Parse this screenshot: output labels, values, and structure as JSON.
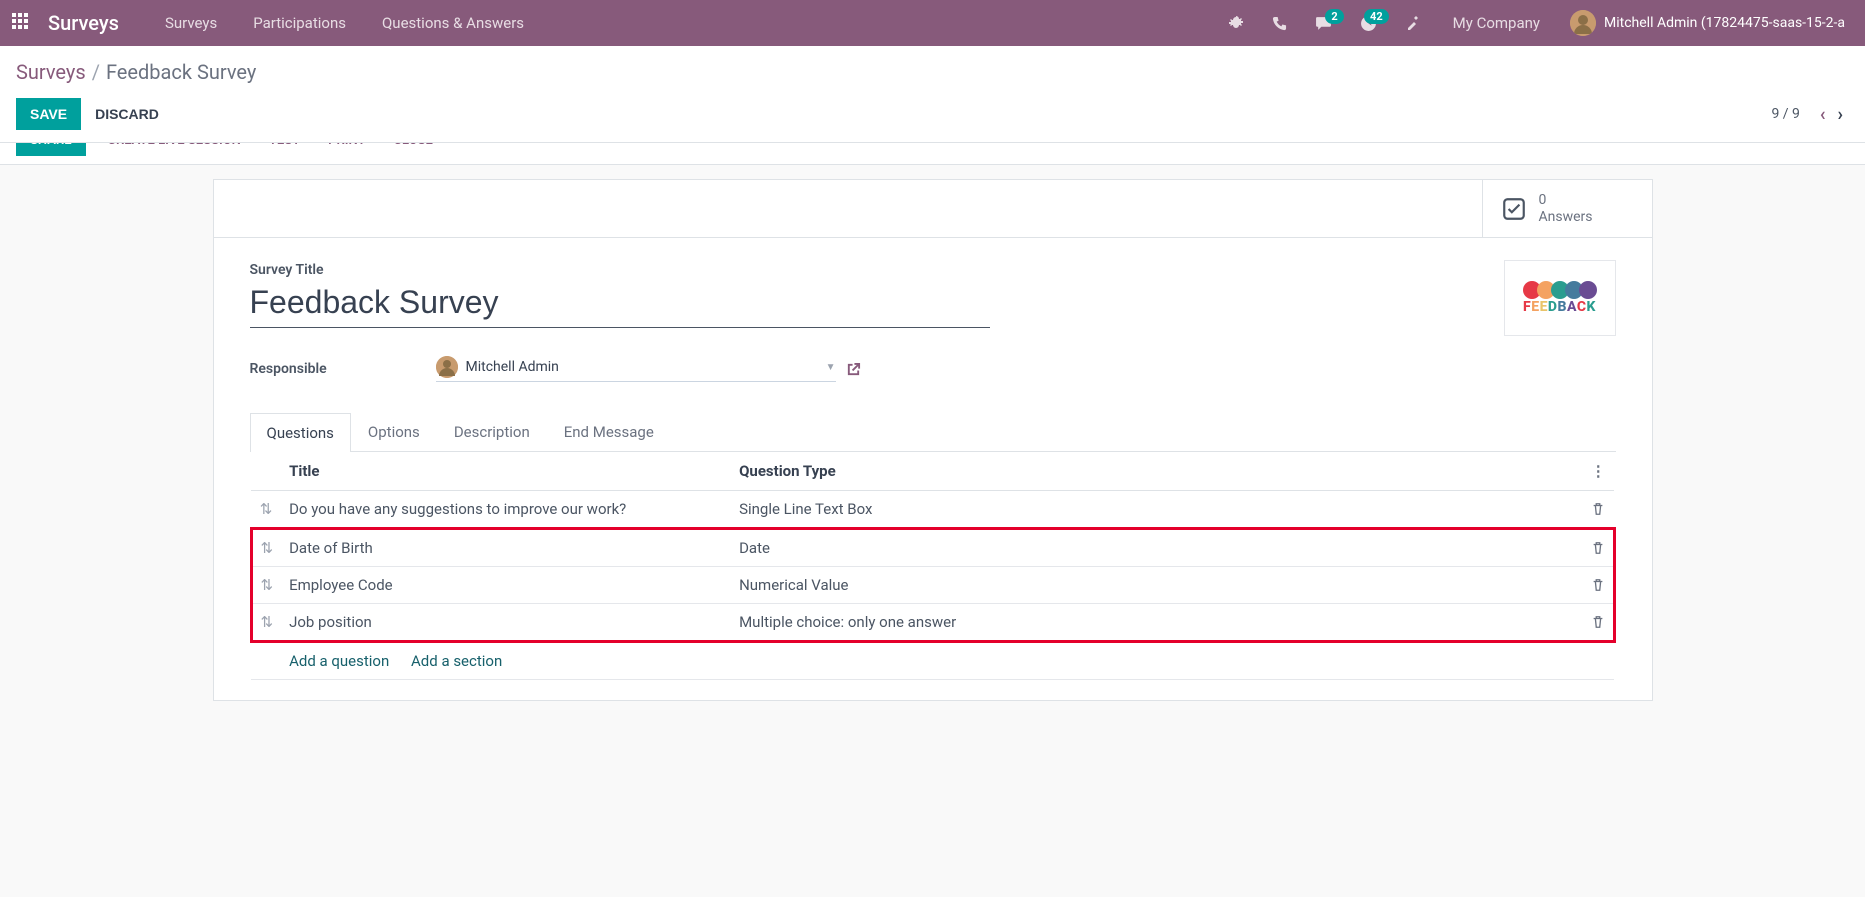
{
  "navbar": {
    "brand": "Surveys",
    "links": [
      "Surveys",
      "Participations",
      "Questions & Answers"
    ],
    "msg_badge": "2",
    "activity_badge": "42",
    "company": "My Company",
    "user": "Mitchell Admin (17824475-saas-15-2-a"
  },
  "breadcrumb": {
    "root": "Surveys",
    "current": "Feedback Survey"
  },
  "actions": {
    "save": "SAVE",
    "discard": "DISCARD",
    "pager": "9 / 9"
  },
  "statusbar": {
    "share": "SHARE",
    "live": "CREATE LIVE SESSION",
    "test": "TEST",
    "print": "PRINT",
    "close": "CLOSE"
  },
  "statbtn": {
    "count": "0",
    "label": "Answers"
  },
  "form": {
    "title_label": "Survey Title",
    "title_value": "Feedback Survey",
    "responsible_label": "Responsible",
    "responsible_value": "Mitchell Admin",
    "feedback_caption": "FEEDBACK"
  },
  "tabs": [
    "Questions",
    "Options",
    "Description",
    "End Message"
  ],
  "columns": {
    "title": "Title",
    "type": "Question Type"
  },
  "rows": [
    {
      "title": "Do you have any suggestions to improve our work?",
      "type": "Single Line Text Box"
    },
    {
      "title": "Date of Birth",
      "type": "Date"
    },
    {
      "title": "Employee Code",
      "type": "Numerical Value"
    },
    {
      "title": "Job position",
      "type": "Multiple choice: only one answer"
    }
  ],
  "add": {
    "question": "Add a question",
    "section": "Add a section"
  }
}
